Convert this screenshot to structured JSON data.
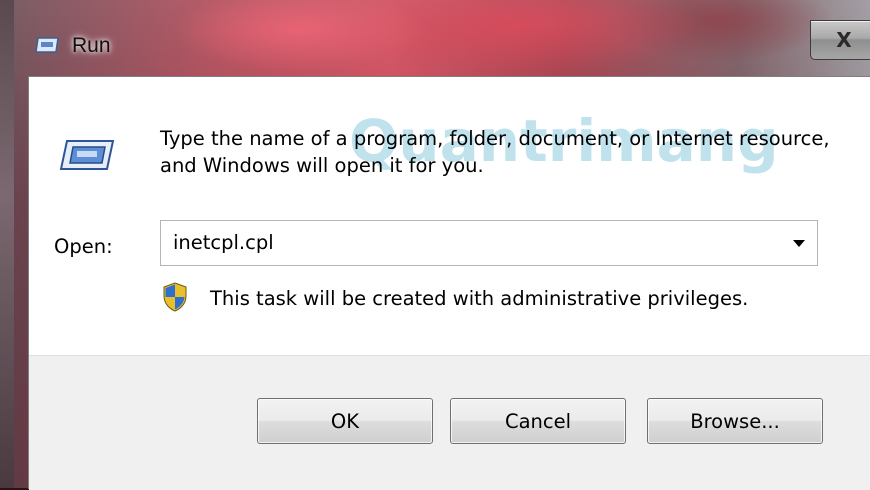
{
  "window": {
    "title": "Run",
    "close_label": "X"
  },
  "dialog": {
    "description": "Type the name of a program, folder, document, or Internet resource, and Windows will open it for you.",
    "watermark": "Quantrimang",
    "open_label": "Open:",
    "open_value": "inetcpl.cpl",
    "admin_notice": "This task will be created with administrative privileges."
  },
  "buttons": {
    "ok": "OK",
    "cancel": "Cancel",
    "browse": "Browse..."
  },
  "icons": {
    "title": "run-icon",
    "main": "run-icon",
    "dropdown": "chevron-down-icon",
    "uac": "uac-shield-icon"
  },
  "colors": {
    "client_bg": "#ffffff",
    "button_area_bg": "#f0f0f0",
    "watermark": "#1e96be"
  }
}
